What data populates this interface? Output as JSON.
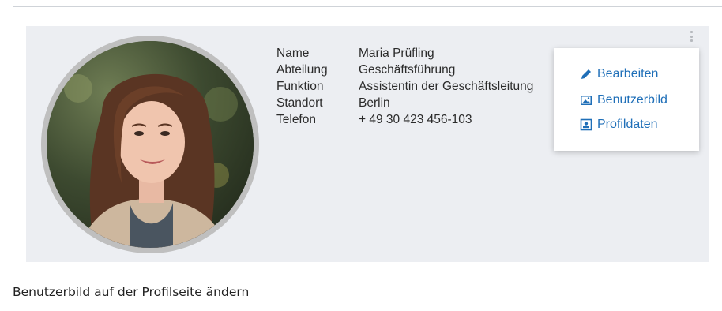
{
  "profile": {
    "fields": [
      {
        "label": "Name",
        "value": "Maria Prüfling"
      },
      {
        "label": "Abteilung",
        "value": "Geschäftsführung"
      },
      {
        "label": "Funktion",
        "value": "Assistentin der Geschäftsleitung"
      },
      {
        "label": "Standort",
        "value": "Berlin"
      },
      {
        "label": "Telefon",
        "value": "+ 49 30 423 456-103"
      }
    ]
  },
  "menu": {
    "edit_label": "Bearbeiten",
    "edit_icon": "pencil-icon",
    "picture_label": "Benutzerbild",
    "picture_icon": "image-icon",
    "profile_label": "Profildaten",
    "profile_icon": "profile-card-icon",
    "accent_color": "#1f6fb8"
  },
  "caption": "Benutzerbild auf der Profilseite ändern"
}
